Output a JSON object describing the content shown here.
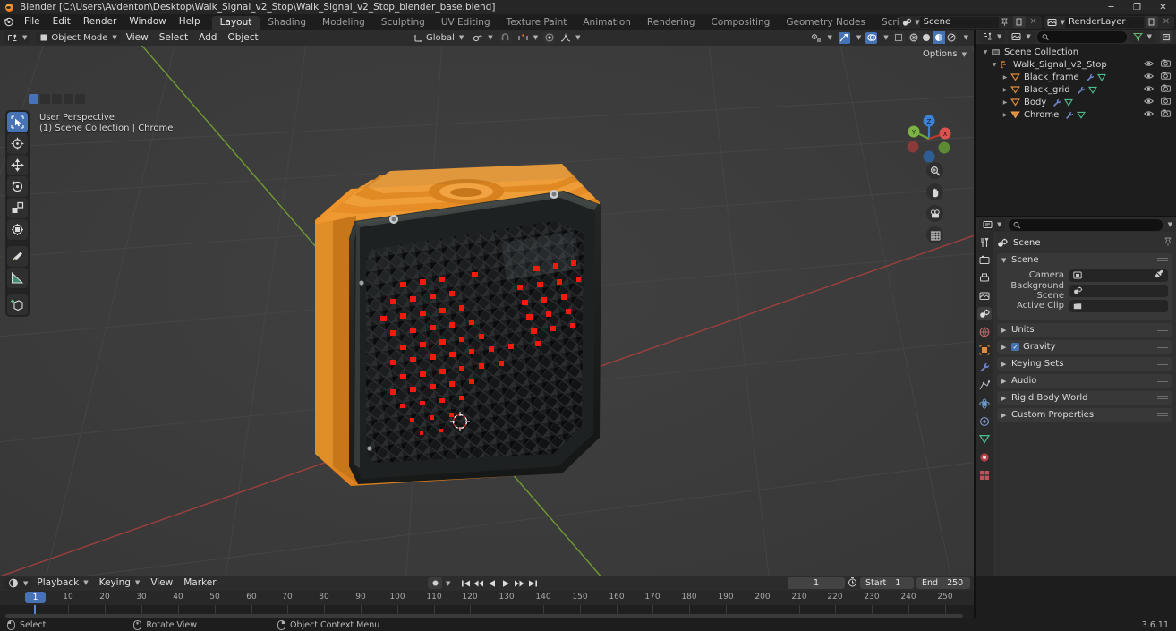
{
  "window": {
    "title": "Blender [C:\\Users\\Avdenton\\Desktop\\Walk_Signal_v2_Stop\\Walk_Signal_v2_Stop_blender_base.blend]",
    "minimize": "─",
    "maximize": "❐",
    "close": "✕"
  },
  "menubar": {
    "items": [
      "File",
      "Edit",
      "Render",
      "Window",
      "Help"
    ]
  },
  "workspace_tabs": {
    "items": [
      "Layout",
      "Shading",
      "Modeling",
      "Sculpting",
      "UV Editing",
      "Texture Paint",
      "Animation",
      "Rendering",
      "Compositing",
      "Geometry Nodes",
      "Scripting"
    ],
    "active": "Layout",
    "add_label": "+"
  },
  "topbar_right": {
    "scene_name": "Scene",
    "viewlayer_name": "RenderLayer"
  },
  "viewport_header": {
    "mode": "Object Mode",
    "menus": [
      "View",
      "Select",
      "Add",
      "Object"
    ],
    "transform_orientation": "Global",
    "options_label": "Options"
  },
  "viewport": {
    "perspective_label": "User Perspective",
    "collection_label": "(1) Scene Collection | Chrome",
    "gizmo_axes": {
      "x": "X",
      "y": "Y",
      "z": "Z"
    },
    "colors": {
      "background": "#393939",
      "axis_x": "#a33b3b",
      "axis_y": "#6b9e33",
      "grid": "#4a4a4a",
      "body_orange": "#e08824",
      "grid_black": "#1b1b1b",
      "led_red": "#ef2010",
      "accent_blue": "#4772b3"
    },
    "toolbar_tools": [
      "select-box-tool",
      "cursor-tool",
      "move-tool",
      "rotate-tool",
      "scale-tool",
      "transform-tool",
      "annotate-tool",
      "measure-tool",
      "add-cube-tool"
    ],
    "nav_buttons": [
      "zoom-icon",
      "pan-hand-icon",
      "camera-icon",
      "grid-ortho-icon"
    ]
  },
  "outliner": {
    "search_placeholder": "",
    "scene_collection": "Scene Collection",
    "rows": [
      {
        "label": "Walk_Signal_v2_Stop",
        "type": "collection",
        "depth": 0,
        "expanded": true
      },
      {
        "label": "Black_frame",
        "type": "mesh",
        "depth": 1,
        "expanded": false
      },
      {
        "label": "Black_grid",
        "type": "mesh",
        "depth": 1,
        "expanded": false
      },
      {
        "label": "Body",
        "type": "mesh",
        "depth": 1,
        "expanded": false
      },
      {
        "label": "Chrome",
        "type": "mesh",
        "depth": 1,
        "expanded": false,
        "active": true
      }
    ]
  },
  "properties": {
    "breadcrumb": "Scene",
    "tabs": [
      "tool-tab",
      "render-tab",
      "output-tab",
      "view-layer-tab",
      "scene-tab",
      "world-tab",
      "object-tab",
      "modifier-tab",
      "particles-tab",
      "physics-tab",
      "constraints-tab",
      "data-tab",
      "material-tab",
      "texture-tab"
    ],
    "active_tab": "scene-tab",
    "scene_panel": {
      "title": "Scene",
      "rows": [
        {
          "label": "Camera",
          "value": ""
        },
        {
          "label": "Background Scene",
          "value": ""
        },
        {
          "label": "Active Clip",
          "value": ""
        }
      ]
    },
    "panels": [
      {
        "label": "Units",
        "checkbox": false
      },
      {
        "label": "Gravity",
        "checkbox": true
      },
      {
        "label": "Keying Sets",
        "checkbox": false
      },
      {
        "label": "Audio",
        "checkbox": false
      },
      {
        "label": "Rigid Body World",
        "checkbox": false
      },
      {
        "label": "Custom Properties",
        "checkbox": false
      }
    ]
  },
  "timeline": {
    "menus": [
      "Playback",
      "Keying",
      "View",
      "Marker"
    ],
    "current_frame": "1",
    "start_label": "Start",
    "start_value": "1",
    "end_label": "End",
    "end_value": "250",
    "ticks": [
      "10",
      "20",
      "30",
      "40",
      "50",
      "60",
      "70",
      "80",
      "90",
      "100",
      "110",
      "120",
      "130",
      "140",
      "150",
      "160",
      "170",
      "180",
      "190",
      "200",
      "210",
      "220",
      "230",
      "240",
      "250"
    ],
    "playhead_label": "1"
  },
  "statusbar": {
    "items": [
      {
        "icon": "mouse-left-icon",
        "label": "Select"
      },
      {
        "icon": "mouse-middle-icon",
        "label": "Rotate View"
      },
      {
        "icon": "mouse-right-icon",
        "label": "Object Context Menu"
      }
    ],
    "version": "3.6.11"
  }
}
